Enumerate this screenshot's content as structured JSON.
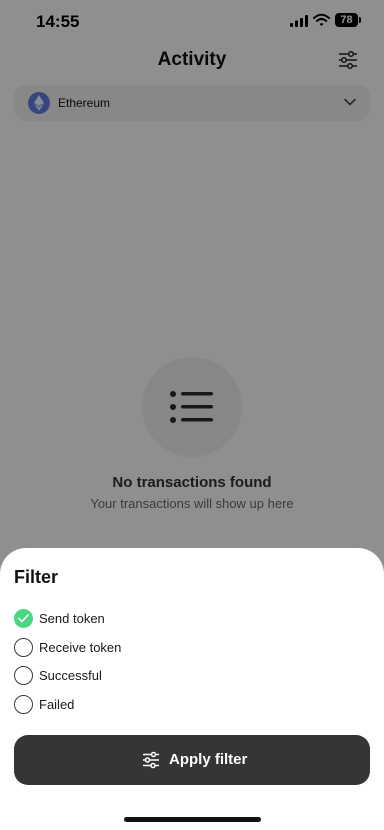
{
  "status_bar": {
    "time": "14:55",
    "battery": "78"
  },
  "header": {
    "title": "Activity",
    "filter_icon": "sliders-icon"
  },
  "network": {
    "label": "Ethereum",
    "icon": "ethereum-icon"
  },
  "empty_state": {
    "icon": "list-icon",
    "title": "No transactions found",
    "subtitle": "Your transactions will show up here"
  },
  "filter_sheet": {
    "title": "Filter",
    "options": [
      {
        "label": "Send token",
        "checked": true
      },
      {
        "label": "Receive token",
        "checked": false
      },
      {
        "label": "Successful",
        "checked": false
      },
      {
        "label": "Failed",
        "checked": false
      }
    ],
    "apply_label": "Apply filter"
  },
  "colors": {
    "check_green": "#4cd680",
    "button_dark": "#353535",
    "eth_blue": "#627eea"
  }
}
